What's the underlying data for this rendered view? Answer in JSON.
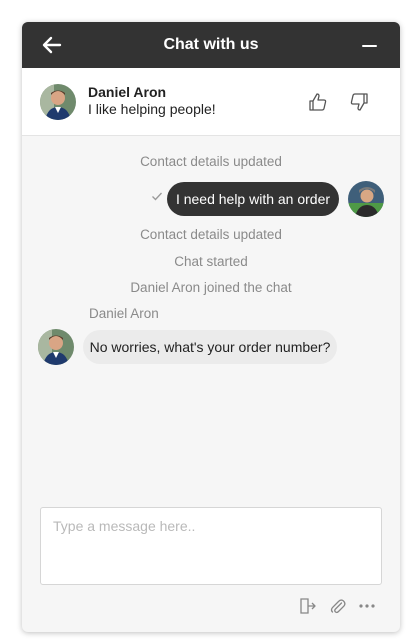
{
  "header": {
    "title": "Chat with us",
    "back_icon": "arrow-left-icon",
    "minimize_icon": "minus-icon"
  },
  "agent": {
    "name": "Daniel Aron",
    "tagline": "I like helping people!",
    "rate_up_icon": "thumbs-up-icon",
    "rate_down_icon": "thumbs-down-icon"
  },
  "messages": {
    "system_1": "Contact details updated",
    "user_message": "I need help with an order",
    "system_2": "Contact details updated",
    "system_3": "Chat started",
    "system_4": "Daniel Aron joined the chat",
    "agent_sender": "Daniel Aron",
    "agent_message": "No worries, what's your order number?"
  },
  "composer": {
    "placeholder": "Type a message here..",
    "value": ""
  },
  "toolbar": {
    "end_chat_icon": "exit-icon",
    "attach_icon": "paperclip-icon",
    "more_icon": "more-horizontal-icon"
  },
  "colors": {
    "header_bg": "#333333",
    "user_bubble": "#333333",
    "agent_bubble": "#ebebeb",
    "panel_bg": "#f6f6f6",
    "muted_text": "#8a8a8a"
  }
}
